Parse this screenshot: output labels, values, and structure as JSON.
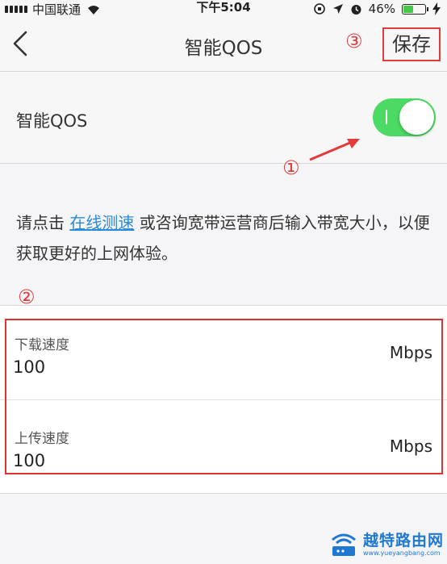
{
  "status_bar": {
    "carrier": "中国联通",
    "time": "下午5:04",
    "battery": "46%",
    "battery_level": 0.46
  },
  "nav": {
    "title": "智能QOS",
    "save_label": "保存"
  },
  "annotations": {
    "one": "①",
    "two": "②",
    "three": "③"
  },
  "qos": {
    "label": "智能QOS",
    "enabled": true
  },
  "description": {
    "prefix": "请点击 ",
    "link": "在线测速",
    "suffix": " 或咨询宽带运营商后输入带宽大小，以便获取更好的上网体验。"
  },
  "form": {
    "download": {
      "label": "下载速度",
      "value": "100",
      "unit": "Mbps"
    },
    "upload": {
      "label": "上传速度",
      "value": "100",
      "unit": "Mbps"
    }
  },
  "watermark": {
    "name": "越特路由网",
    "url": "www.yueyangbang.com"
  },
  "colors": {
    "toggle_on": "#4cd964",
    "annotation_red": "#e23b3b",
    "link_blue": "#2b8bd8"
  }
}
